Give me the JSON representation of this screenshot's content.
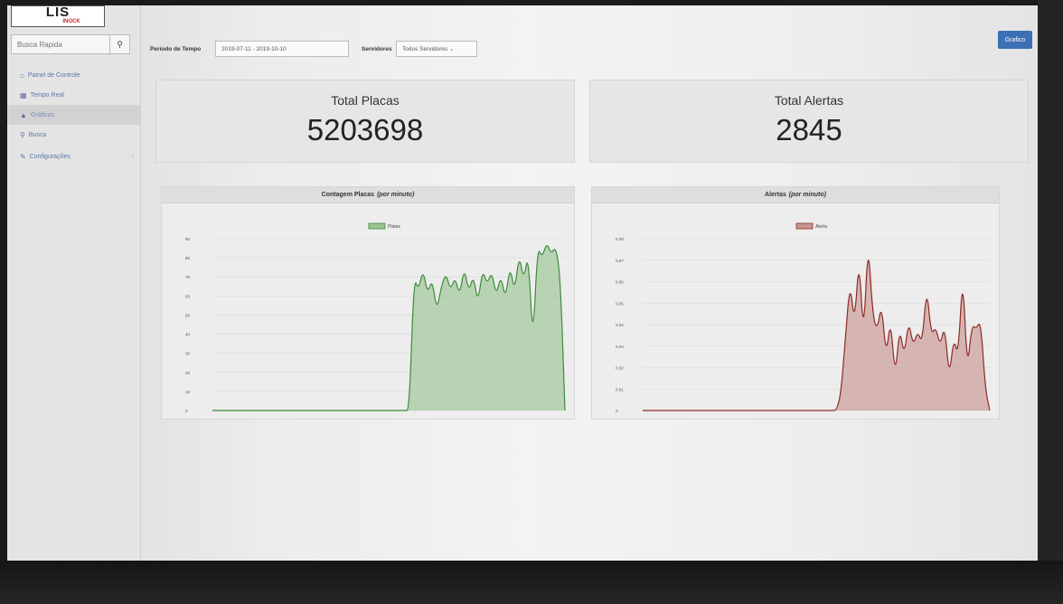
{
  "logo": {
    "main": "LIS",
    "sub": "INOCK"
  },
  "search": {
    "placeholder": "Busca Rapida"
  },
  "nav": [
    {
      "icon": "⌂",
      "label": "Painel de Controle"
    },
    {
      "icon": "▦",
      "label": "Tempo Real"
    },
    {
      "icon": "▲",
      "label": "Gráficos"
    },
    {
      "icon": "⚲",
      "label": "Busca"
    },
    {
      "icon": "✎",
      "label": "Configurações"
    }
  ],
  "filters": {
    "period_label": "Período de Tempo",
    "period_value": "2019-07-11 - 2019-10-10",
    "servers_label": "Servidores",
    "servers_value": "Todos Servidores ⌄"
  },
  "graph_button": "Grafico",
  "stats": {
    "plates": {
      "title": "Total Placas",
      "value": "5203698"
    },
    "alerts": {
      "title": "Total Alertas",
      "value": "2845"
    }
  },
  "charts": {
    "plates": {
      "title": "Contagem Placas",
      "title_suffix": "(por minuto)"
    },
    "alerts": {
      "title": "Alertas",
      "title_suffix": "(por minuto)"
    }
  },
  "colors": {
    "plates_line": "#3f8a3a",
    "plates_fill": "#9bc494",
    "alerts_line": "#8e2b25",
    "alerts_fill": "#c99590",
    "accent": "#3c6fb3"
  },
  "chart_data": [
    {
      "type": "area",
      "series": [
        {
          "name": "Plates",
          "values": [
            0,
            0,
            0,
            0,
            0,
            0,
            0,
            0,
            0,
            0,
            0,
            0,
            0,
            0,
            0,
            0,
            0,
            0,
            0,
            0,
            0,
            0,
            0,
            0,
            0,
            0,
            0,
            0,
            0,
            0,
            0,
            0,
            0,
            0,
            0,
            0,
            0,
            0,
            0,
            0,
            0,
            0,
            0,
            0,
            70,
            63,
            74,
            61,
            69,
            52,
            65,
            72,
            63,
            70,
            60,
            75,
            62,
            71,
            56,
            74,
            66,
            73,
            60,
            71,
            58,
            76,
            62,
            82,
            68,
            83,
            34,
            86,
            80,
            88,
            82,
            86,
            70,
            0
          ]
        }
      ],
      "ylim": [
        0,
        90
      ],
      "yticks": [
        0,
        10,
        20,
        30,
        40,
        50,
        60,
        70,
        80,
        90
      ],
      "legend": "top-center",
      "grid": true
    },
    {
      "type": "area",
      "series": [
        {
          "name": "Alerta",
          "values": [
            0,
            0,
            0,
            0,
            0,
            0,
            0,
            0,
            0,
            0,
            0,
            0,
            0,
            0,
            0,
            0,
            0,
            0,
            0,
            0,
            0,
            0,
            0,
            0,
            0,
            0,
            0,
            0,
            0,
            0,
            0,
            0,
            0,
            0,
            0,
            0,
            0,
            0,
            0,
            0,
            0,
            0,
            0,
            0,
            0.008,
            0.035,
            0.06,
            0.04,
            0.072,
            0.033,
            0.08,
            0.045,
            0.037,
            0.05,
            0.025,
            0.043,
            0.015,
            0.039,
            0.025,
            0.042,
            0.03,
            0.037,
            0.031,
            0.058,
            0.035,
            0.039,
            0.03,
            0.04,
            0.015,
            0.034,
            0.025,
            0.065,
            0.018,
            0.04,
            0.038,
            0.042,
            0.01,
            0
          ]
        }
      ],
      "ylim": [
        0,
        0.08
      ],
      "yticks": [
        0,
        0.01,
        0.02,
        0.03,
        0.04,
        0.05,
        0.06,
        0.07,
        0.08
      ],
      "legend": "top-center",
      "grid": true
    }
  ]
}
